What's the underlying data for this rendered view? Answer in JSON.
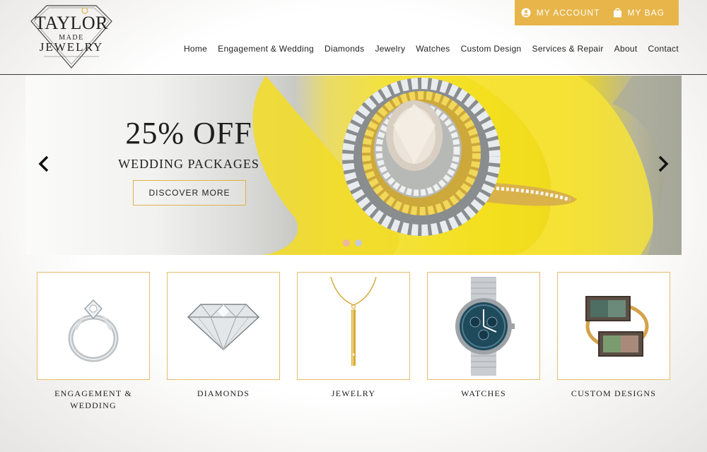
{
  "brand": {
    "line1": "TAYLOR",
    "line2": "MADE",
    "line3": "JEWELRY",
    "accent_color": "#e7b54a"
  },
  "account_bar": {
    "my_account": "MY ACCOUNT",
    "my_bag": "MY BAG",
    "account_icon": "user-icon",
    "bag_icon": "shopping-bag-icon"
  },
  "nav": {
    "items": [
      {
        "label": "Home"
      },
      {
        "label": "Engagement & Wedding"
      },
      {
        "label": "Diamonds"
      },
      {
        "label": "Jewelry"
      },
      {
        "label": "Watches"
      },
      {
        "label": "Custom Design"
      },
      {
        "label": "Services & Repair"
      },
      {
        "label": "About"
      },
      {
        "label": "Contact"
      }
    ]
  },
  "hero": {
    "title": "25% OFF",
    "subtitle": "WEDDING PACKAGES",
    "cta": "DISCOVER MORE",
    "prev_icon": "chevron-left-icon",
    "next_icon": "chevron-right-icon",
    "slide_count": 2,
    "active_slide": 1
  },
  "categories": [
    {
      "label": "ENGAGEMENT & WEDDING",
      "icon": "engagement-ring-icon"
    },
    {
      "label": "DIAMONDS",
      "icon": "diamond-icon"
    },
    {
      "label": "JEWELRY",
      "icon": "pendant-necklace-icon"
    },
    {
      "label": "WATCHES",
      "icon": "wristwatch-icon"
    },
    {
      "label": "CUSTOM DESIGNS",
      "icon": "gemstone-rings-icon"
    }
  ]
}
